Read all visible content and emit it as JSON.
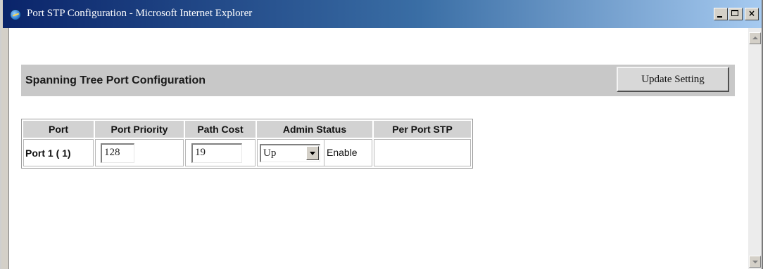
{
  "window": {
    "title": "Port STP Configuration - Microsoft Internet Explorer"
  },
  "header": {
    "title": "Spanning Tree Port Configuration",
    "update_button": "Update Setting"
  },
  "table": {
    "columns": [
      "Port",
      "Port Priority",
      "Path Cost",
      "Admin Status",
      "Per Port STP"
    ],
    "rows": [
      {
        "port": "Port 1 ( 1)",
        "priority": "128",
        "path_cost": "19",
        "admin_status": "Up",
        "state": "Enable",
        "per_port_stp": ""
      }
    ]
  },
  "icons": {
    "app": "ie-globe-icon",
    "minimize": "minimize-icon",
    "maximize": "maximize-icon",
    "close": "close-icon",
    "dropdown": "chevron-down-icon"
  }
}
